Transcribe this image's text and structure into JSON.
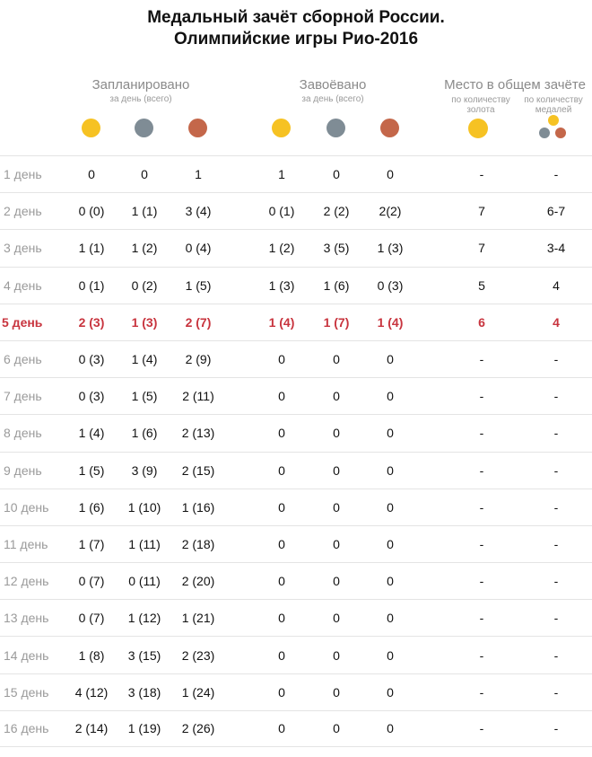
{
  "title_line1": "Медальный зачёт сборной России.",
  "title_line2": "Олимпийские игры Рио-2016",
  "headers": {
    "planned": "Запланировано",
    "planned_sub": "за день (всего)",
    "won": "Завоёвано",
    "won_sub": "за день (всего)",
    "place": "Место в общем зачёте",
    "place_gold_sub1": "по количеству",
    "place_gold_sub2": "золота",
    "place_medals_sub1": "по количеству",
    "place_medals_sub2": "медалей"
  },
  "colors": {
    "gold": "#f6c223",
    "silver": "#7f8c95",
    "bronze": "#c4674a",
    "highlight": "#c8343e"
  },
  "highlight_row_index": 4,
  "rows": [
    {
      "day": "1 день",
      "pg": "0",
      "ps": "0",
      "pb": "1",
      "wg": "1",
      "ws": "0",
      "wb": "0",
      "place_gold": "-",
      "place_medals": "-"
    },
    {
      "day": "2 день",
      "pg": "0 (0)",
      "ps": "1 (1)",
      "pb": "3 (4)",
      "wg": "0 (1)",
      "ws": "2 (2)",
      "wb": "2(2)",
      "place_gold": "7",
      "place_medals": "6-7"
    },
    {
      "day": "3 день",
      "pg": "1 (1)",
      "ps": "1 (2)",
      "pb": "0 (4)",
      "wg": "1 (2)",
      "ws": "3 (5)",
      "wb": "1 (3)",
      "place_gold": "7",
      "place_medals": "3-4"
    },
    {
      "day": "4 день",
      "pg": "0 (1)",
      "ps": "0 (2)",
      "pb": "1 (5)",
      "wg": "1 (3)",
      "ws": "1 (6)",
      "wb": "0 (3)",
      "place_gold": "5",
      "place_medals": "4"
    },
    {
      "day": "5 день",
      "pg": "2 (3)",
      "ps": "1 (3)",
      "pb": "2 (7)",
      "wg": "1 (4)",
      "ws": "1 (7)",
      "wb": "1 (4)",
      "place_gold": "6",
      "place_medals": "4"
    },
    {
      "day": "6 день",
      "pg": "0 (3)",
      "ps": "1 (4)",
      "pb": "2 (9)",
      "wg": "0",
      "ws": "0",
      "wb": "0",
      "place_gold": "-",
      "place_medals": "-"
    },
    {
      "day": "7 день",
      "pg": "0 (3)",
      "ps": "1 (5)",
      "pb": "2 (11)",
      "wg": "0",
      "ws": "0",
      "wb": "0",
      "place_gold": "-",
      "place_medals": "-"
    },
    {
      "day": "8 день",
      "pg": "1 (4)",
      "ps": "1 (6)",
      "pb": "2 (13)",
      "wg": "0",
      "ws": "0",
      "wb": "0",
      "place_gold": "-",
      "place_medals": "-"
    },
    {
      "day": "9 день",
      "pg": "1 (5)",
      "ps": "3 (9)",
      "pb": "2 (15)",
      "wg": "0",
      "ws": "0",
      "wb": "0",
      "place_gold": "-",
      "place_medals": "-"
    },
    {
      "day": "10 день",
      "pg": "1 (6)",
      "ps": "1 (10)",
      "pb": "1 (16)",
      "wg": "0",
      "ws": "0",
      "wb": "0",
      "place_gold": "-",
      "place_medals": "-"
    },
    {
      "day": "11 день",
      "pg": "1 (7)",
      "ps": "1 (11)",
      "pb": "2 (18)",
      "wg": "0",
      "ws": "0",
      "wb": "0",
      "place_gold": "-",
      "place_medals": "-"
    },
    {
      "day": "12 день",
      "pg": "0 (7)",
      "ps": "0 (11)",
      "pb": "2 (20)",
      "wg": "0",
      "ws": "0",
      "wb": "0",
      "place_gold": "-",
      "place_medals": "-"
    },
    {
      "day": "13 день",
      "pg": "0 (7)",
      "ps": "1 (12)",
      "pb": "1 (21)",
      "wg": "0",
      "ws": "0",
      "wb": "0",
      "place_gold": "-",
      "place_medals": "-"
    },
    {
      "day": "14 день",
      "pg": "1 (8)",
      "ps": "3 (15)",
      "pb": "2 (23)",
      "wg": "0",
      "ws": "0",
      "wb": "0",
      "place_gold": "-",
      "place_medals": "-"
    },
    {
      "day": "15 день",
      "pg": "4 (12)",
      "ps": "3 (18)",
      "pb": "1 (24)",
      "wg": "0",
      "ws": "0",
      "wb": "0",
      "place_gold": "-",
      "place_medals": "-"
    },
    {
      "day": "16 день",
      "pg": "2 (14)",
      "ps": "1 (19)",
      "pb": "2 (26)",
      "wg": "0",
      "ws": "0",
      "wb": "0",
      "place_gold": "-",
      "place_medals": "-"
    }
  ]
}
